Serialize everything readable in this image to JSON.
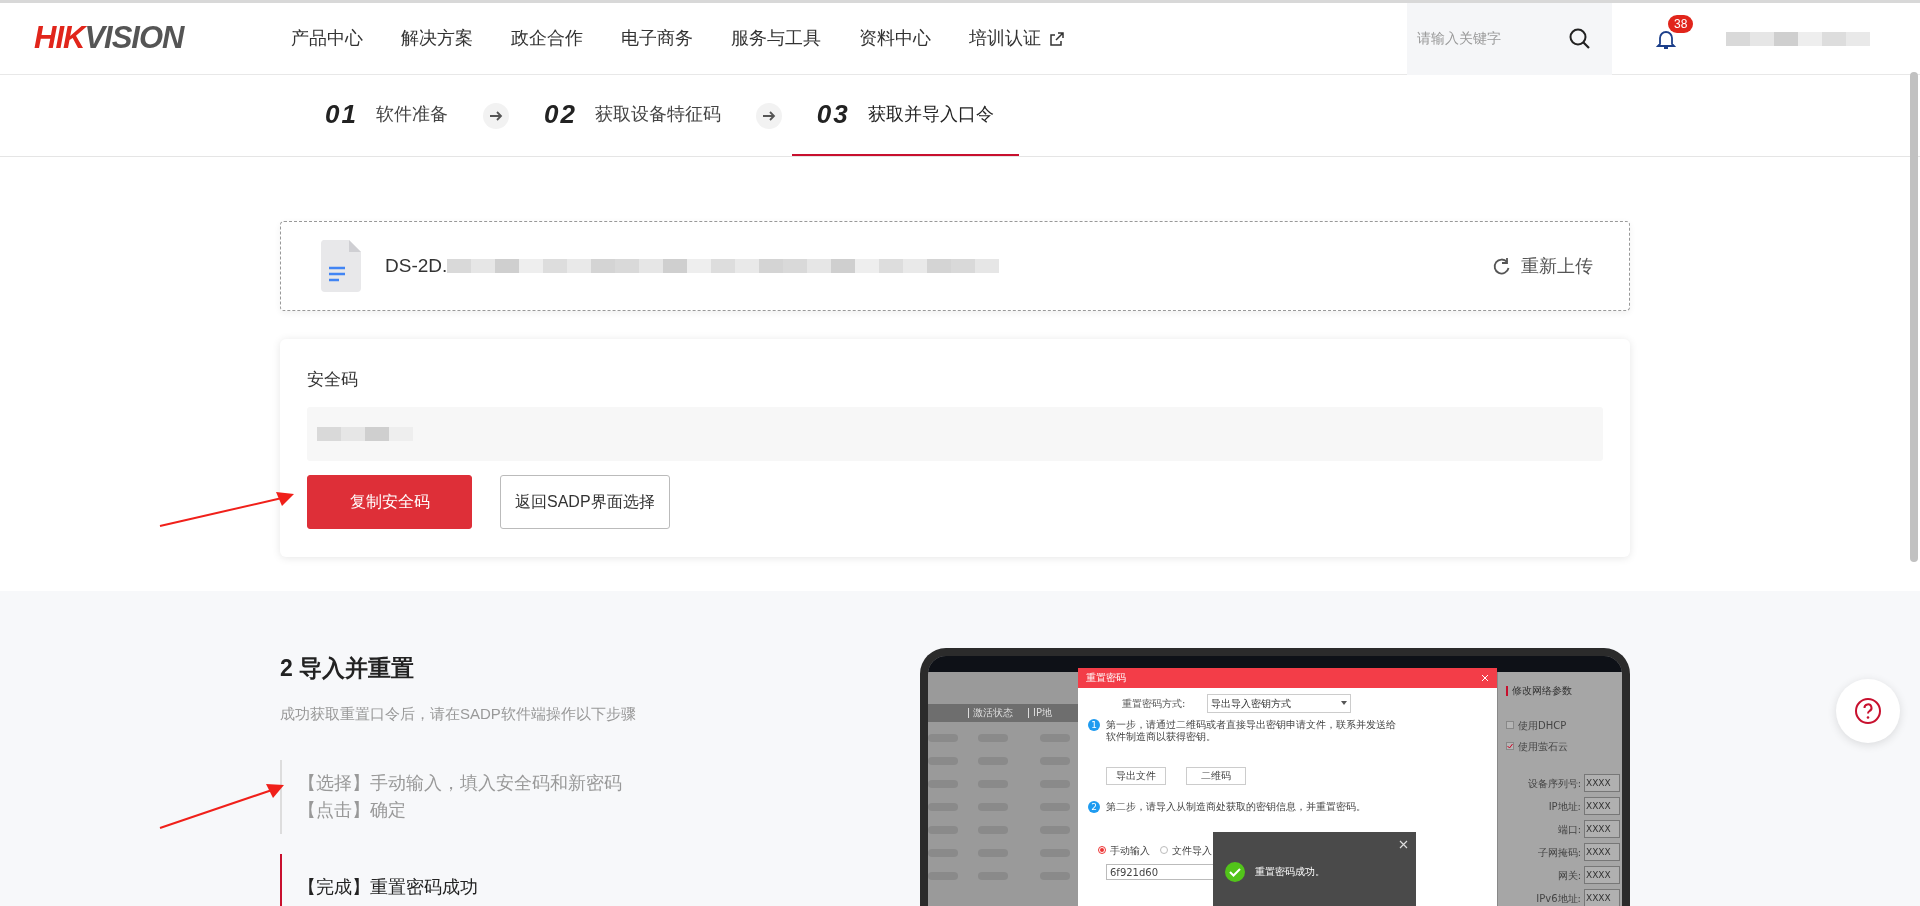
{
  "header": {
    "logo": [
      {
        "text": "HIK",
        "color": "#e1251b"
      },
      {
        "text": "VISION",
        "color": "#555555"
      }
    ],
    "nav": [
      {
        "label": "产品中心",
        "external": false
      },
      {
        "label": "解决方案",
        "external": false
      },
      {
        "label": "政企合作",
        "external": false
      },
      {
        "label": "电子商务",
        "external": false
      },
      {
        "label": "服务与工具",
        "external": false
      },
      {
        "label": "资料中心",
        "external": false
      },
      {
        "label": "培训认证",
        "external": true
      }
    ],
    "search": {
      "placeholder": "请输入关键字"
    },
    "notifications": "38"
  },
  "steps": [
    {
      "number": "01",
      "label": "软件准备",
      "selected": false
    },
    {
      "number": "02",
      "label": "获取设备特征码",
      "selected": false
    },
    {
      "number": "03",
      "label": "获取并导入口令",
      "selected": true
    }
  ],
  "file": {
    "name": "DS-2D.",
    "action": "重新上传"
  },
  "security": {
    "label": "安全码",
    "buttons": [
      {
        "label": "复制安全码",
        "kind": "primary"
      },
      {
        "label": "返回SADP界面选择",
        "kind": "outline"
      }
    ]
  },
  "guide": {
    "title": "2 导入并重置",
    "subtitle": "成功获取重置口令后，请在SADP软件端操作以下步骤",
    "items": [
      {
        "lines": [
          "【选择】手动输入，填入安全码和新密码",
          "【点击】确定"
        ],
        "active": false
      },
      {
        "lines": [
          "【完成】重置密码成功"
        ],
        "active": true
      }
    ]
  },
  "screenshot": {
    "table_headers": [
      "激活状态",
      "IP地"
    ],
    "dialog": {
      "title": "重置密码",
      "method_label": "重置密码方式:",
      "method_value": "导出导入密钥方式",
      "step_1": {
        "number": "1",
        "text": "第一步，请通过二维码或者直接导出密钥申请文件，联系并发送给软件制造商以获得密钥。"
      },
      "buttons": [
        "导出文件",
        "二维码"
      ],
      "step_2": {
        "number": "2",
        "text": "第二步，请导入从制造商处获取的密钥信息，并重置密码。"
      },
      "radios": [
        {
          "label": "手动输入",
          "selected": true
        },
        {
          "label": "文件导入",
          "selected": false
        }
      ],
      "input_value": "6f921d60"
    },
    "toast": "重置密码成功。",
    "panel": {
      "title": "修改网络参数",
      "checkboxes": [
        {
          "label": "使用DHCP",
          "checked": false
        },
        {
          "label": "使用萤石云",
          "checked": true
        }
      ],
      "fields": [
        {
          "label": "设备序列号:",
          "value": "XXXX"
        },
        {
          "label": "IP地址:",
          "value": "XXXX"
        },
        {
          "label": "端口:",
          "value": "XXXX"
        },
        {
          "label": "子网掩码:",
          "value": "XXXX"
        },
        {
          "label": "网关:",
          "value": "XXXX"
        },
        {
          "label": "IPv6地址:",
          "value": "XXXX"
        }
      ]
    }
  }
}
